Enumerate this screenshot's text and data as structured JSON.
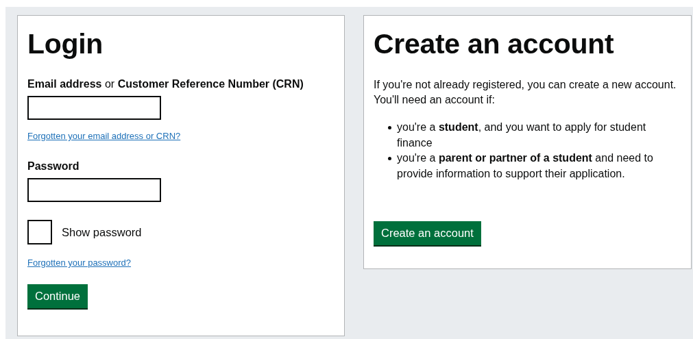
{
  "login": {
    "heading": "Login",
    "email_label": "**Email address** or **Customer Reference Number (CRN)**",
    "forgot_email_link": "Forgotten your email address or CRN?",
    "password_label": "Password",
    "show_password": {
      "label": "Show password",
      "checked": false
    },
    "forgot_password_link": "Forgotten your password?",
    "button": "Continue"
  },
  "create_account": {
    "heading": "Create an account",
    "intro": [
      "If you're not already registered, you can create a new account.",
      "You'll need an account if:"
    ],
    "items": [
      "you're a **student**, and you want to apply for student finance",
      "you're a **parent or partner of a student** and need to provide information to support their application."
    ],
    "button": "Create an account"
  }
}
